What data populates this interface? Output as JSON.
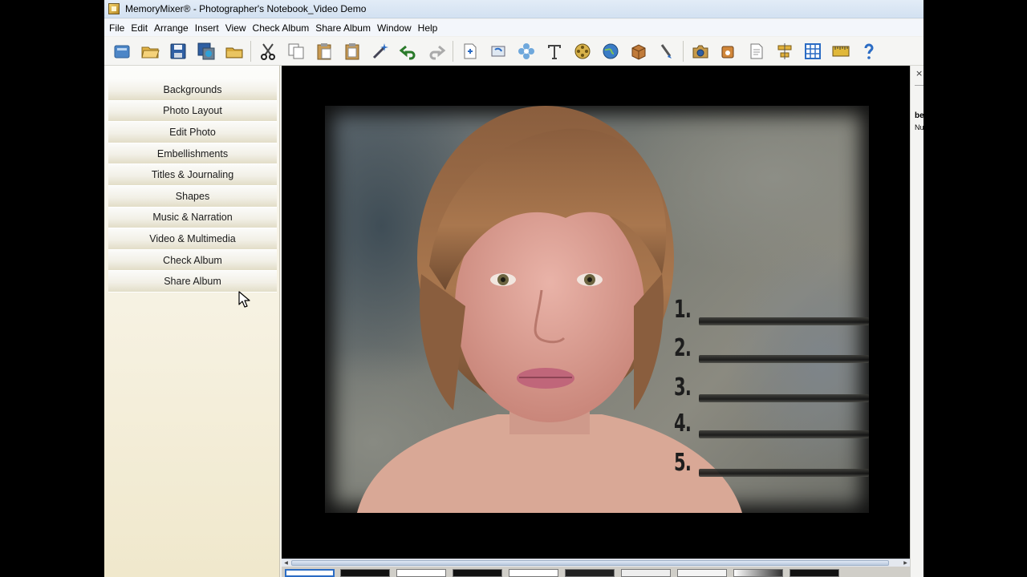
{
  "window": {
    "title": "MemoryMixer® - Photographer's Notebook_Video Demo"
  },
  "menu": [
    "File",
    "Edit",
    "Arrange",
    "Insert",
    "View",
    "Check Album",
    "Share Album",
    "Window",
    "Help"
  ],
  "toolbar": {
    "icons": [
      "new-album-icon",
      "open-folder-icon",
      "save-icon",
      "save-as-icon",
      "folder-icon",
      "cut-icon",
      "copy-icon",
      "paste-icon",
      "paste-special-icon",
      "magic-wand-icon",
      "undo-icon",
      "redo-icon",
      "add-page-icon",
      "rotate-icon",
      "flower-icon",
      "text-icon",
      "film-reel-icon",
      "globe-icon",
      "package-icon",
      "paintbrush-icon",
      "camera-icon",
      "music-icon",
      "document-icon",
      "align-icon",
      "grid-icon",
      "ruler-icon",
      "help-icon"
    ]
  },
  "sidebar": {
    "items": [
      "Backgrounds",
      "Photo Layout",
      "Edit Photo",
      "Embellishments",
      "Titles & Journaling",
      "Shapes",
      "Music & Narration",
      "Video & Multimedia",
      "Check Album",
      "Share Album"
    ]
  },
  "page": {
    "list_numbers": [
      "1.",
      "2.",
      "3.",
      "4.",
      "5."
    ]
  },
  "right_panel": {
    "close": "×",
    "text1": "be",
    "text2": "Nu"
  },
  "scrollbar": {
    "left_arrow": "◀",
    "right_arrow": "▶"
  },
  "colors": {
    "canvas": "#000000",
    "sidebar_bg": "#f4efdc",
    "titlebar": "#dce8f5"
  }
}
